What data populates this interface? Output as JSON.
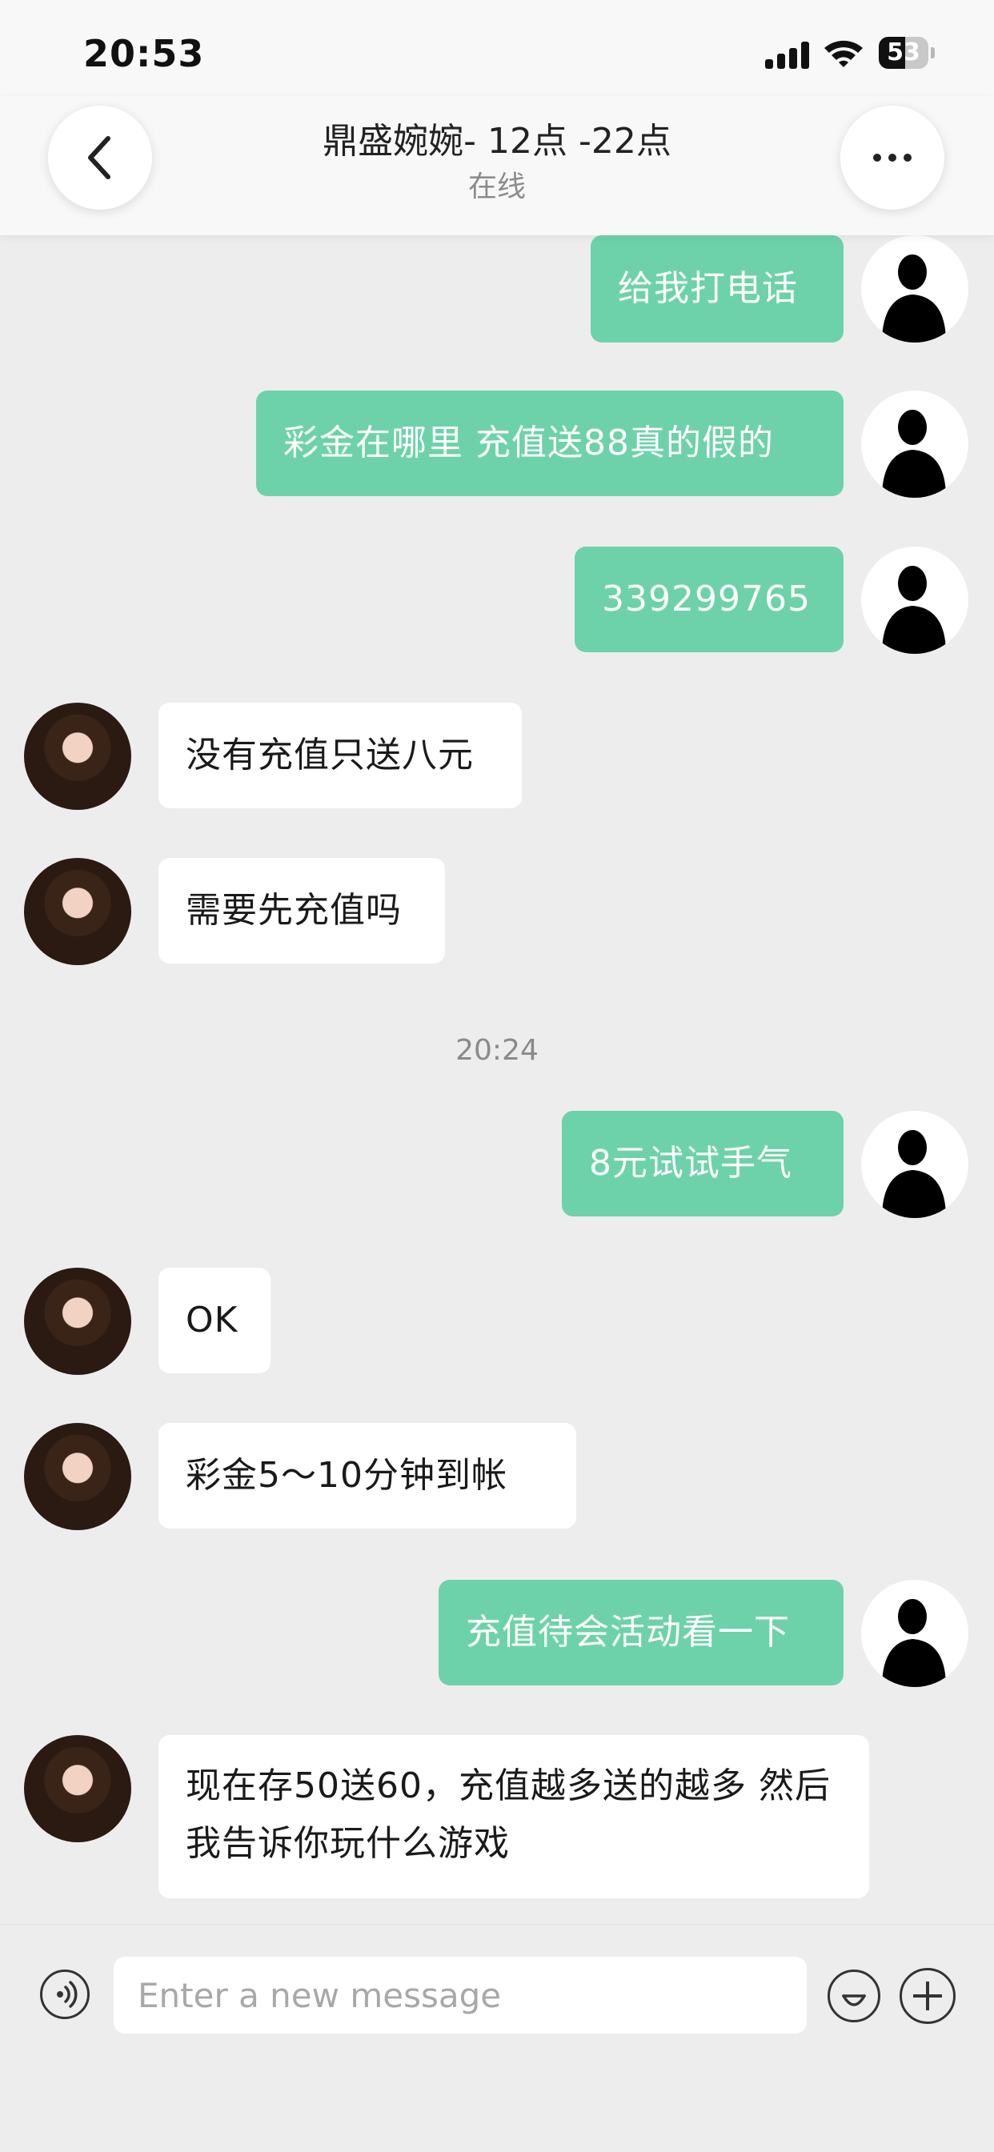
{
  "status_bar": {
    "time": "20:53",
    "battery": "53",
    "battery_level": 0.53
  },
  "header": {
    "title": "鼎盛婉婉- 12点 -22点",
    "subtitle": "在线"
  },
  "messages": [
    {
      "side": "sent",
      "text": "给我打电话"
    },
    {
      "side": "sent",
      "text": "彩金在哪里 充值送88真的假的"
    },
    {
      "side": "sent",
      "text": "339299765"
    },
    {
      "side": "received",
      "text": "没有充值只送八元"
    },
    {
      "side": "received",
      "text": "需要先充值吗"
    },
    {
      "side": "timestamp",
      "text": "20:24"
    },
    {
      "side": "sent",
      "text": "8元试试手气"
    },
    {
      "side": "received",
      "text": "OK"
    },
    {
      "side": "received",
      "text": "彩金5～10分钟到帐"
    },
    {
      "side": "sent",
      "text": "充值待会活动看一下"
    },
    {
      "side": "received",
      "text": "现在存50送60，充值越多送的越多 然后我告诉你玩什么游戏"
    }
  ],
  "input": {
    "placeholder": "Enter a new message",
    "value": ""
  },
  "colors": {
    "sent_bubble": "#6dd2aa",
    "received_bubble": "#ffffff",
    "background": "#ededed"
  }
}
